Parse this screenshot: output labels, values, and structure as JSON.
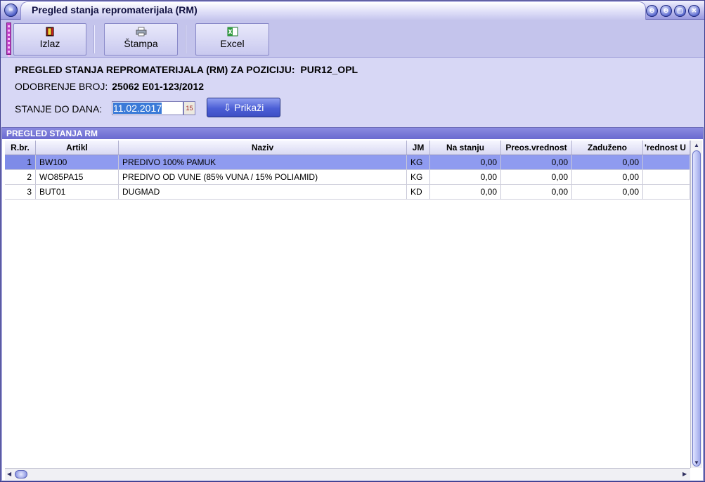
{
  "window": {
    "title": "Pregled stanja repromaterijala (RM)",
    "sys_icon": "≡"
  },
  "window_buttons": [
    "⊖",
    "⊖",
    "▢",
    "✕"
  ],
  "toolbar": {
    "buttons": [
      {
        "label": "Izlaz",
        "icon": "exit-icon"
      },
      {
        "label": "Štampa",
        "icon": "printer-icon"
      },
      {
        "label": "Excel",
        "icon": "excel-icon"
      }
    ]
  },
  "form": {
    "heading_label": "PREGLED STANJA REPROMATERIJALA (RM) ZA POZICIJU:",
    "heading_value": "PUR12_OPL",
    "odobrenje_label": "ODOBRENJE BROJ:",
    "odobrenje_value": "25062 E01-123/2012",
    "stanje_label": "STANJE DO DANA:",
    "date_value": "11.02.2017",
    "calendar_icon": "15",
    "show_button": "Prikaži",
    "show_icon": "⇩"
  },
  "section": {
    "title": "PREGLED STANJA RM"
  },
  "table": {
    "columns": [
      "R.br.",
      "Artikl",
      "Naziv",
      "JM",
      "Na stanju",
      "Preos.vrednost",
      "Zaduženo",
      "'rednost U"
    ],
    "rows": [
      {
        "rbr": "1",
        "artikl": "BW100",
        "naziv": "PREDIVO 100% PAMUK",
        "jm": "KG",
        "na_stanju": "0,00",
        "preos": "0,00",
        "zaduzeno": "0,00",
        "vrednost": ""
      },
      {
        "rbr": "2",
        "artikl": "WO85PA15",
        "naziv": "PREDIVO OD VUNE (85% VUNA / 15% POLIAMID)",
        "jm": "KG",
        "na_stanju": "0,00",
        "preos": "0,00",
        "zaduzeno": "0,00",
        "vrednost": ""
      },
      {
        "rbr": "3",
        "artikl": "BUT01",
        "naziv": "DUGMAD",
        "jm": "KD",
        "na_stanju": "0,00",
        "preos": "0,00",
        "zaduzeno": "0,00",
        "vrednost": ""
      }
    ],
    "selected_row": 1
  },
  "colors": {
    "selection": "#8f9bf0",
    "header_band": "#6a6ad0",
    "window_bg": "#d7d7f5"
  }
}
